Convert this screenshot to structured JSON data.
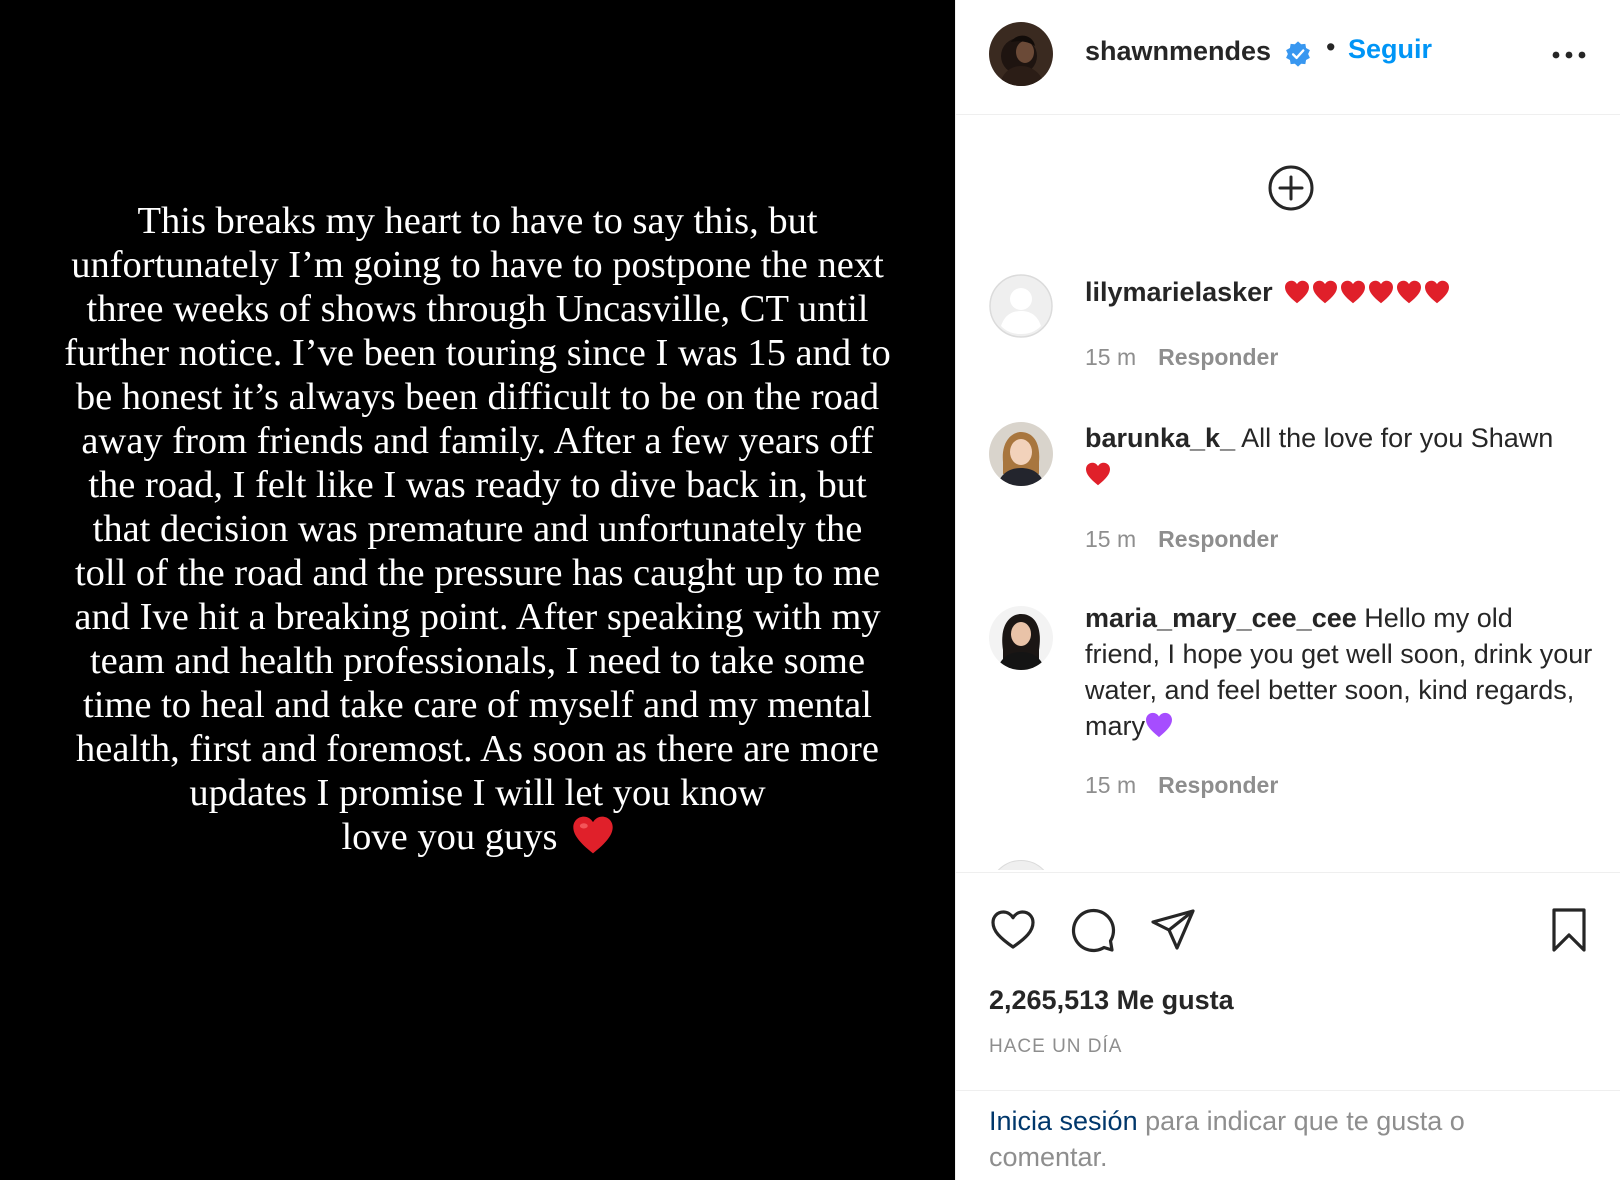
{
  "post": {
    "text_lines": [
      "This breaks my heart to have to say this, but",
      "unfortunately I’m going to have to postpone the next",
      "three weeks of shows through Uncasville, CT until",
      "further notice. I’ve been touring since I was 15 and to",
      "be honest it’s always been difficult to be on the road",
      "away from friends and family. After a few years off",
      "the road, I felt like I was ready to dive back in, but",
      "that decision was premature and unfortunately the",
      "toll of the road and the pressure has caught up to me",
      "and Ive hit a breaking point. After speaking with my",
      "team and health professionals, I need to take some",
      "time to heal and take care of myself and my mental",
      "health, first and foremost. As soon as there are more",
      "updates I promise I will let you know",
      "love you guys"
    ]
  },
  "header": {
    "username": "shawnmendes",
    "separator": "•",
    "follow_label": "Seguir"
  },
  "comments": [
    {
      "user": "lilymarielasker",
      "text": "",
      "time": "15 m",
      "reply": "Responder"
    },
    {
      "user": "barunka_k_",
      "text": " All the love for you Shawn",
      "time": "15 m",
      "reply": "Responder"
    },
    {
      "user": "maria_mary_cee_cee",
      "text": " Hello my old friend, I hope you get well soon, drink your water, and feel better soon, kind regards, mary",
      "time": "15 m",
      "reply": "Responder"
    }
  ],
  "likes": "2,265,513 Me gusta",
  "posted": "HACE UN DÍA",
  "login": {
    "link": "Inicia sesión",
    "rest": " para indicar que te gusta o comentar."
  },
  "colors": {
    "accent": "#0095f6",
    "link_dark": "#00376b",
    "muted": "#8e8e8e",
    "heart_red": "#e0202a",
    "purple_heart": "#a64dff"
  }
}
